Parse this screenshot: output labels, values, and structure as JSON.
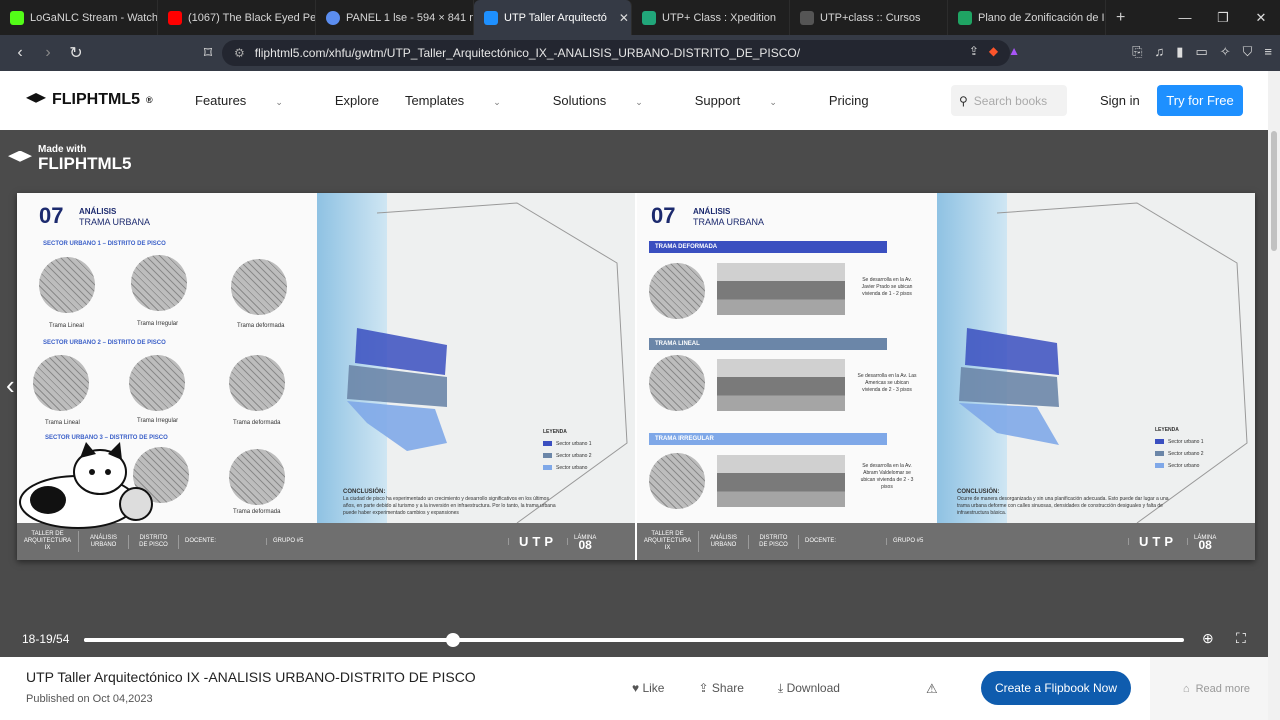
{
  "tabs": [
    {
      "label": "LoGaNLC Stream - Watch",
      "color": "#53fc18",
      "active": false
    },
    {
      "label": "(1067) The Black Eyed Pea",
      "color": "#ff0000",
      "active": false
    },
    {
      "label": "PANEL 1 lse - 594 × 841 m",
      "color": "#5b8def",
      "active": false
    },
    {
      "label": "UTP Taller Arquitectó",
      "color": "#1e90ff",
      "active": true
    },
    {
      "label": "UTP+ Class : Xpedition",
      "color": "#21a67a",
      "active": false
    },
    {
      "label": "UTP+class :: Cursos",
      "color": "#555555",
      "active": false
    },
    {
      "label": "Plano de Zonificación de I",
      "color": "#1fa463",
      "active": false
    }
  ],
  "address": {
    "url": "fliphtml5.com/xhfu/gwtm/UTP_Taller_Arquitectónico_IX_-ANALISIS_URBANO-DISTRITO_DE_PISCO/"
  },
  "site": {
    "brand": "FLIPHTML5",
    "nav": [
      "Features",
      "Explore",
      "Templates",
      "Solutions",
      "Support",
      "Pricing"
    ],
    "search_placeholder": "Search books",
    "signin": "Sign in",
    "try": "Try for Free"
  },
  "viewer": {
    "made_small": "Made with",
    "made_big": "FLIPHTML5",
    "left": {
      "num": "07",
      "title": "ANÁLISIS",
      "subtitle": "TRAMA URBANA",
      "sector1": "SECTOR URBANO 1 – DISTRITO DE PISCO",
      "sector2": "SECTOR URBANO 2 – DISTRITO DE PISCO",
      "sector3": "SECTOR URBANO 3 – DISTRITO DE PISCO",
      "l1": "Trama Lineal",
      "l2": "Trama Irregular",
      "l3": "Trama deformada",
      "legend": "LEYENDA",
      "leg1": "Sector urbano 1",
      "leg2": "Sector urbano 2",
      "leg3": "Sector urbano",
      "conc_title": "CONCLUSIÓN:",
      "conc": "La ciudad de pisco ha experimentado un crecimiento y desarrollo significativos en los últimos años, en parte debido al turismo y a la inversión en infraestructura. Por lo tanto, la trama urbana puede haber experimentado cambios y expansiones"
    },
    "right": {
      "num": "07",
      "title": "ANÁLISIS",
      "subtitle": "TRAMA URBANA",
      "bar1": "TRAMA DEFORMADA",
      "bar2": "TRAMA LINEAL",
      "bar3": "TRAMA IRREGULAR",
      "d1": "Se desarrolla en la Av. Javier Prado se ubican vivienda de 1 - 2 pisos",
      "d2": "Se desarrolla en la Av. Las Americas se ubican vivienda de 2 - 3 pisos",
      "d3": "Se desarrolla en la Av. Abram Valdelomar se ubican vivienda de 2 - 3 pisos",
      "legend": "LEYENDA",
      "leg1": "Sector urbano 1",
      "leg2": "Sector urbano 2",
      "leg3": "Sector urbano",
      "conc_title": "CONCLUSIÓN:",
      "conc": "Ocurre de manera desorganizada y sin una planificación adecuada. Esto puede dar lugar a una trama urbana deforme con calles sinuosas, densidades de construcción desiguales y falta de infraestructura básica."
    },
    "footer": {
      "taller": "TALLER DE ARQUITECTURA IX",
      "analisis": "ANÁLISIS URBANO",
      "distrito": "DISTRITO DE PISCO",
      "docente": "DOCENTE:",
      "grupo": "GRUPO #5",
      "utp": "UTP",
      "lamina": "LÁMINA",
      "num": "08"
    }
  },
  "controls": {
    "page": "18-19/54",
    "progress": 0.335
  },
  "info": {
    "title": "UTP Taller Arquitectónico IX -ANALISIS URBANO-DISTRITO DE PISCO",
    "published": "Published on Oct 04,2023",
    "like": "Like",
    "share": "Share",
    "download": "Download",
    "create": "Create a Flipbook Now",
    "readmore": "Read more"
  },
  "colors": {
    "accent": "#1e90ff",
    "create": "#0f5cae",
    "sector1": "#3a4fc0",
    "sector2": "#6b86a8",
    "sector3": "#7fa8e8"
  }
}
